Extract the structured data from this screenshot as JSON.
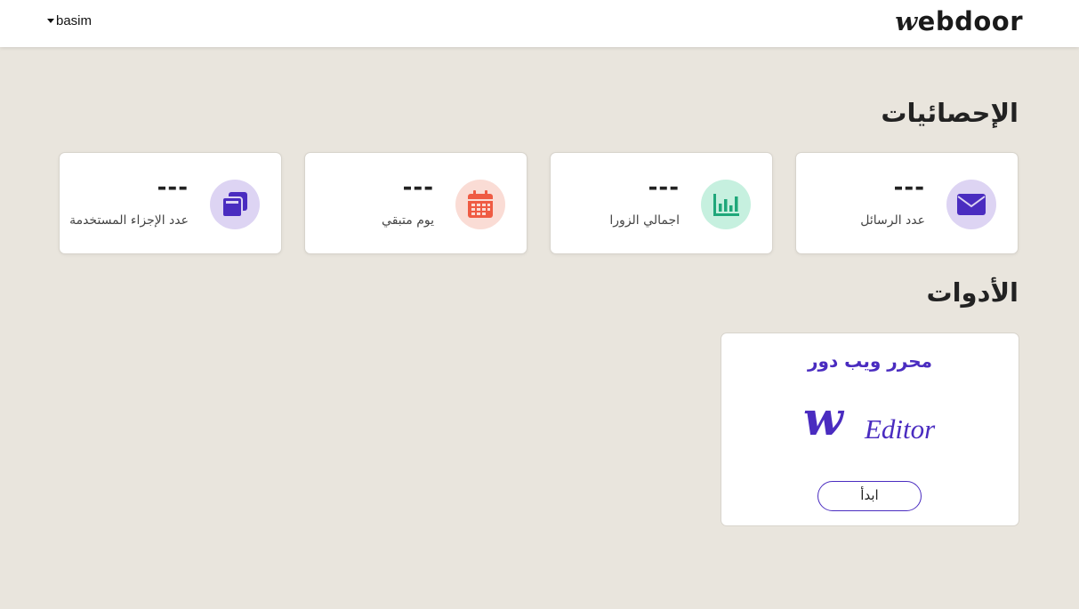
{
  "header": {
    "user_name": "basim",
    "logo_text": "ebdoor",
    "logo_mark": "w"
  },
  "stats": {
    "title": "الإحصائيات",
    "cards": [
      {
        "label": "عدد الرسائل",
        "value": "---",
        "icon": "envelope-icon",
        "icon_bg": "#ddd4f3",
        "icon_color": "#4a2cc0"
      },
      {
        "label": "اجمالي الزورا",
        "value": "---",
        "icon": "bar-chart-icon",
        "icon_bg": "#c6f0df",
        "icon_color": "#1fa77a"
      },
      {
        "label": "يوم متبقي",
        "value": "---",
        "icon": "calendar-icon",
        "icon_bg": "#fadcd5",
        "icon_color": "#ef5b43"
      },
      {
        "label": "عدد الإجزاء المستخدمة",
        "value": "---",
        "icon": "copy-icon",
        "icon_bg": "#ddd4f3",
        "icon_color": "#4a2cc0"
      }
    ]
  },
  "tools": {
    "title": "الأدوات",
    "editor": {
      "title": "محرر ويب دور",
      "logo_mark": "w",
      "logo_text": "Editor",
      "button_label": "ابدأ"
    }
  },
  "colors": {
    "accent": "#4a2cc0",
    "background": "#e9e5dd"
  }
}
